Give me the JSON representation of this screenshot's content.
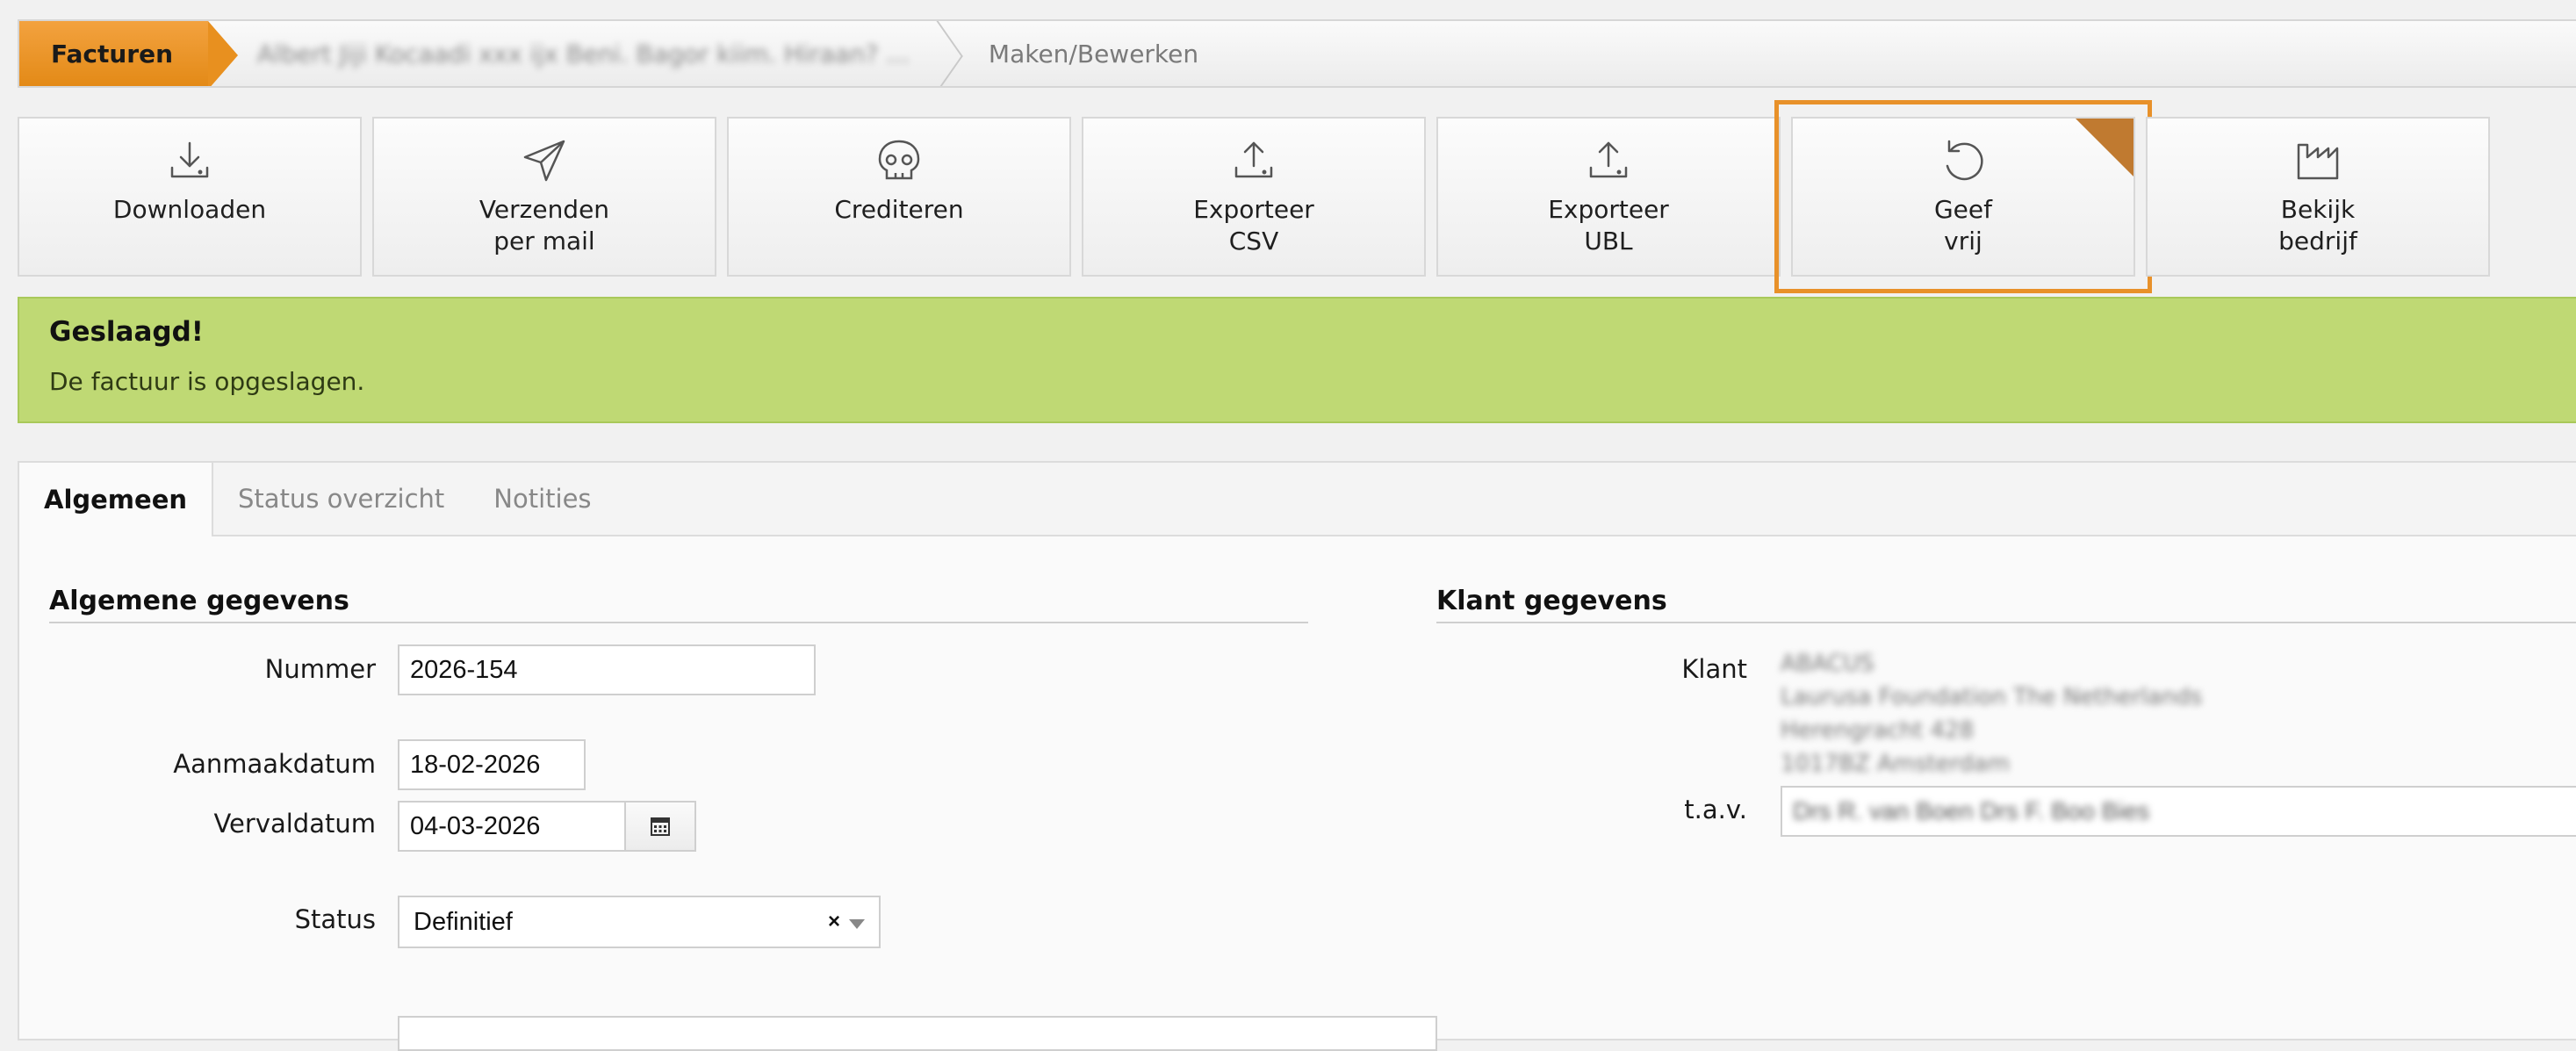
{
  "breadcrumb": {
    "first": "Facturen",
    "middle": "Albert Jiji Kocaadi xxx ijx Beni. Bagor kiim. Hiraan? ...",
    "last": "Maken/Bewerken"
  },
  "toolbar": {
    "download": "Downloaden",
    "send_mail": "Verzenden\nper mail",
    "credit": "Crediteren",
    "export_csv": "Exporteer\nCSV",
    "export_ubl": "Exporteer\nUBL",
    "release": "Geef\nvrij",
    "view_company": "Bekijk\nbedrijf"
  },
  "alert": {
    "title": "Geslaagd!",
    "message": "De factuur is opgeslagen."
  },
  "tabs": [
    "Algemeen",
    "Status overzicht",
    "Notities"
  ],
  "general": {
    "title": "Algemene gegevens",
    "number_label": "Nummer",
    "number_value": "2026-154",
    "created_label": "Aanmaakdatum",
    "created_value": "18-02-2026",
    "due_label": "Vervaldatum",
    "due_value": "04-03-2026",
    "status_label": "Status",
    "status_value": "Definitief"
  },
  "client": {
    "title": "Klant gegevens",
    "client_label": "Klant",
    "client_value": "ABACUS\nLaurusa Foundation The Netherlands\nHerengracht 428\n1017BZ Amsterdam",
    "attn_label": "t.a.v.",
    "attn_value": "Drs R. van Boen Drs F. Boo Bies"
  },
  "colors": {
    "accent": "#e8912a",
    "success_bg": "#bfd974"
  }
}
